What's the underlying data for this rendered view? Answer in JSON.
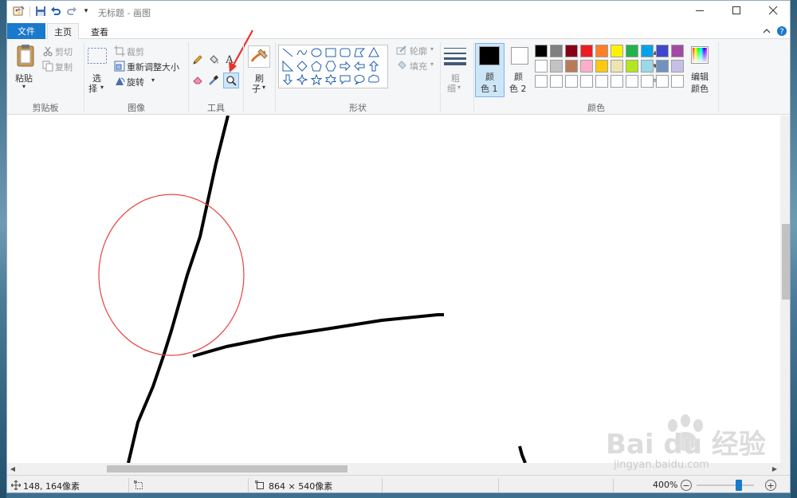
{
  "window": {
    "title": "无标题 - 画图",
    "minimize_icon": "minimize-icon",
    "maximize_icon": "maximize-icon",
    "close_icon": "close-icon"
  },
  "quick_access": {
    "icons": [
      "paint-app-icon",
      "save-icon",
      "undo-icon",
      "redo-icon",
      "customize-dropdown-icon"
    ]
  },
  "tabs": {
    "file": "文件",
    "home": "主页",
    "view": "查看",
    "collapse_icon": "chevron-up-icon",
    "help_icon": "help-icon"
  },
  "clipboard": {
    "paste": "粘贴",
    "cut": "剪切",
    "copy": "复制",
    "group_label": "剪贴板"
  },
  "image": {
    "select_1": "选",
    "select_2": "择",
    "crop": "裁剪",
    "resize": "重新调整大小",
    "rotate": "旋转",
    "group_label": "图像"
  },
  "tools": {
    "group_label": "工具",
    "icons": [
      "pencil-icon",
      "fill-icon",
      "text-icon",
      "eraser-icon",
      "color-picker-icon",
      "magnifier-icon"
    ]
  },
  "brushes": {
    "label_1": "刷",
    "label_2": "子"
  },
  "shapes": {
    "outline": "轮廓",
    "fill": "填充",
    "group_label": "形状"
  },
  "size": {
    "label_1": "粗",
    "label_2": "细"
  },
  "colors": {
    "color1_1": "颜",
    "color1_2": "色 1",
    "color2_1": "颜",
    "color2_2": "色 2",
    "edit_1": "编辑",
    "edit_2": "颜色",
    "group_label": "颜色",
    "color1_value": "#000000",
    "color2_value": "#ffffff",
    "palette": [
      "#000000",
      "#7f7f7f",
      "#880015",
      "#ed1c24",
      "#ff7f27",
      "#fff200",
      "#22b14c",
      "#00a2e8",
      "#3f48cc",
      "#a349a4",
      "#ffffff",
      "#c3c3c3",
      "#b97a57",
      "#ffaec9",
      "#ffc90e",
      "#efe4b0",
      "#b5e61d",
      "#99d9ea",
      "#7092be",
      "#c8bfe7",
      "#ffffff",
      "#ffffff",
      "#ffffff",
      "#ffffff",
      "#ffffff",
      "#ffffff",
      "#ffffff",
      "#ffffff",
      "#ffffff",
      "#ffffff"
    ]
  },
  "status": {
    "cursor_position": "148, 164像素",
    "canvas_size": "864 × 540像素",
    "zoom": "400%"
  },
  "watermark": {
    "main": "Bai du 经验",
    "sub": "jingyan.baidu.com"
  }
}
